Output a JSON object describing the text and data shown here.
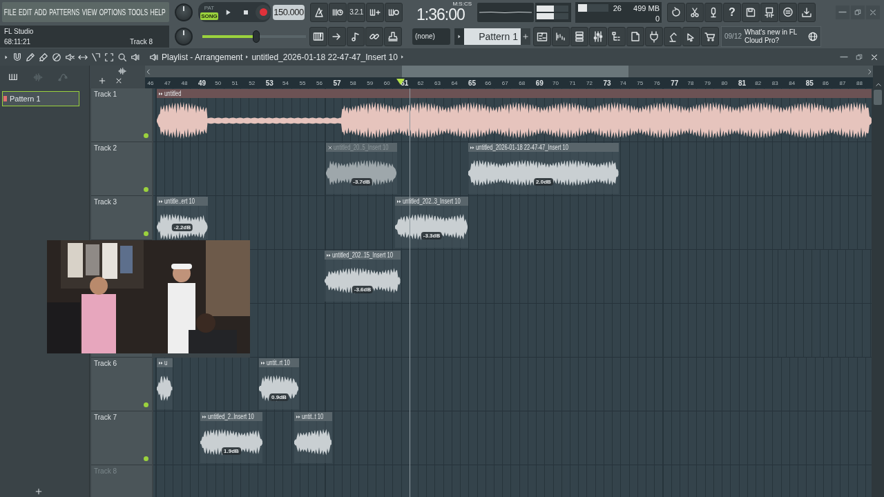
{
  "menu": [
    "FILE",
    "EDIT",
    "ADD",
    "PATTERNS",
    "VIEW",
    "OPTIONS",
    "TOOLS",
    "HELP"
  ],
  "transport": {
    "modes": [
      {
        "label": "PAT",
        "selected": false
      },
      {
        "label": "SONG",
        "selected": true
      }
    ],
    "tempo": "150.000",
    "countdown": "3.2.1"
  },
  "time": {
    "value": "1:36:00",
    "unit": "M:S:CS"
  },
  "output_meters": [
    {
      "level": 0.55
    },
    {
      "level": 0.55
    }
  ],
  "cpu": {
    "level": 0.3,
    "voices": "26",
    "memory": "499 MB",
    "polyphony": "0"
  },
  "help_label": "?",
  "hint_bar": {
    "title": "FL Studio",
    "time": "68:11:21",
    "track": "Track 8"
  },
  "master_volume": {
    "level": 0.52
  },
  "channel_select": {
    "value": "(none)"
  },
  "pattern_select": {
    "value": "Pattern 1"
  },
  "news": {
    "date": "09/12",
    "text": "What's new in FL Cloud Pro?"
  },
  "playlist": {
    "title": "Playlist - Arrangement",
    "clip": "untitled_2026-01-18 22-47-47_Insert 10",
    "patterns": [
      {
        "label": "Pattern 1",
        "selected": true
      }
    ],
    "ruler": [
      "46",
      "47",
      "48",
      "49",
      "50",
      "51",
      "52",
      "53",
      "54",
      "55",
      "56",
      "57",
      "58",
      "59",
      "60",
      "61",
      "62",
      "63",
      "64",
      "65",
      "66",
      "67",
      "68",
      "69",
      "70",
      "71",
      "72",
      "73",
      "74",
      "75",
      "76",
      "77",
      "78",
      "79",
      "80",
      "81",
      "82",
      "83",
      "84",
      "85",
      "86",
      "87",
      "88"
    ],
    "tracks": [
      {
        "label": "Track 1",
        "active": true,
        "clips": [
          {
            "name": "untitled",
            "color": "#e6c4bd",
            "muted": false
          }
        ]
      },
      {
        "label": "Track 2",
        "active": true,
        "clips": [
          {
            "name": "untitled_20..5_Insert 10",
            "color": "#9ea7ab",
            "muted": true,
            "gain": "-3.7dB"
          },
          {
            "name": "untitled_2026-01-18 22-47-47_Insert 10",
            "color": "#c9cfd2",
            "muted": false,
            "gain": "2.0dB"
          }
        ]
      },
      {
        "label": "Track 3",
        "active": true,
        "clips": [
          {
            "name": "untitle..ert 10",
            "color": "#c9cfd2",
            "muted": false,
            "gain": "-2.2dB"
          },
          {
            "name": "untitled_202..3_Insert 10",
            "color": "#c9cfd2",
            "muted": false,
            "gain": "-3.3dB"
          }
        ]
      },
      {
        "clips": [
          {
            "name": "untitled_202..15_Insert 10",
            "color": "#c9cfd2",
            "muted": false,
            "gain": "-3.6dB"
          }
        ]
      },
      {
        "label": "Track 6",
        "active": true,
        "clips": [
          {
            "name": "u",
            "color": "#c9cfd2",
            "muted": false
          },
          {
            "name": "untit..rt 10",
            "color": "#c9cfd2",
            "muted": false,
            "gain": "0.9dB"
          }
        ]
      },
      {
        "label": "Track 7",
        "active": true,
        "clips": [
          {
            "name": "untitled_2..Insert 10",
            "color": "#c9cfd2",
            "muted": false,
            "gain": "1.9dB"
          },
          {
            "name": "untit..t 10",
            "color": "#c9cfd2",
            "muted": false
          }
        ]
      },
      {
        "label": "Track 8",
        "active": false
      }
    ]
  }
}
